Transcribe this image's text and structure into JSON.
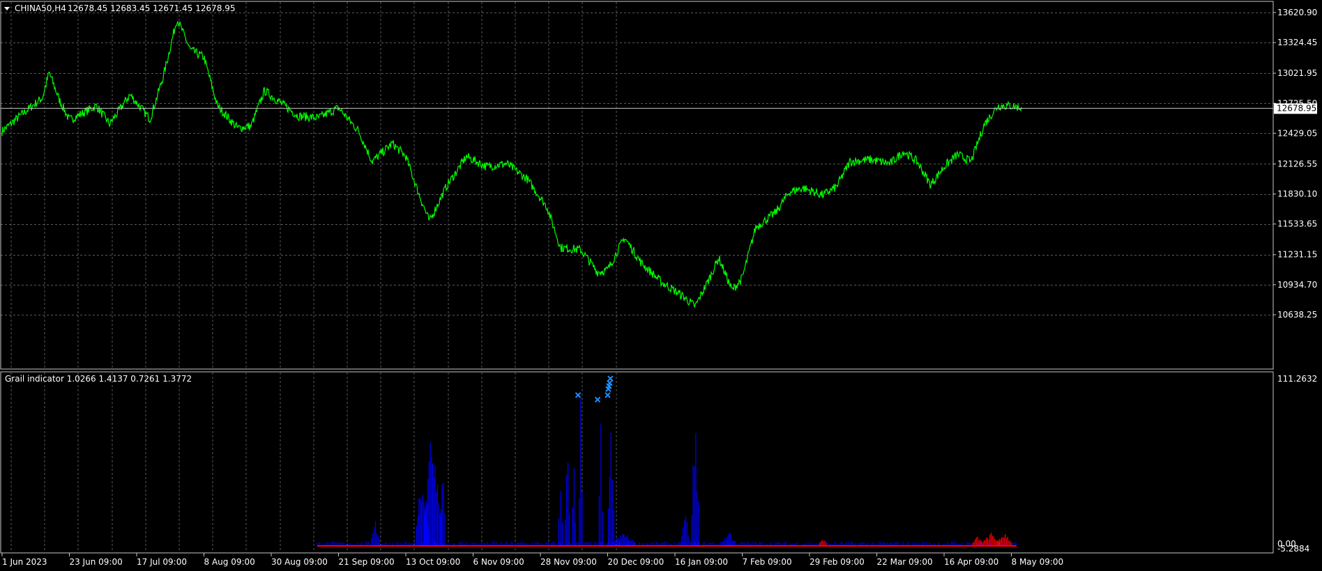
{
  "main_window": {
    "legend_symbol": "CHINA50,H4",
    "legend_ohlc": "12678.45 12683.45 12671.45 12678.95",
    "current_price": "12678.95"
  },
  "indicator_window": {
    "legend": "Grail indicator 1.0266 1.4137 0.7261 1.3772"
  },
  "colors": {
    "background": "#000000",
    "grid": "#5a5a5a",
    "axis_border": "#c8c8c8",
    "price_line": "#00ff00",
    "current_price_line": "#c0c0c0",
    "indicator_blue": "#0000ff",
    "indicator_red": "#ff0000",
    "marker": "#1e90ff"
  },
  "chart_data": [
    {
      "type": "line",
      "series": [
        {
          "name": "CHINA50,H4",
          "x": [
            "1 Jun 2023",
            "23 Jun 09:00",
            "17 Jul 09:00",
            "8 Aug 09:00",
            "30 Aug 09:00",
            "21 Sep 09:00",
            "13 Oct 09:00",
            "6 Nov 09:00",
            "28 Nov 09:00",
            "20 Dec 09:00",
            "16 Jan 09:00",
            "7 Feb 09:00",
            "29 Feb 09:00",
            "22 Mar 09:00",
            "16 Apr 09:00",
            "8 May 09:00"
          ],
          "keypoints": [
            {
              "t": 0.0,
              "v": 12450
            },
            {
              "t": 0.3,
              "v": 12620
            },
            {
              "t": 0.6,
              "v": 12780
            },
            {
              "t": 0.7,
              "v": 13030
            },
            {
              "t": 0.85,
              "v": 12760
            },
            {
              "t": 1.0,
              "v": 12560
            },
            {
              "t": 1.4,
              "v": 12700
            },
            {
              "t": 1.6,
              "v": 12520
            },
            {
              "t": 1.9,
              "v": 12810
            },
            {
              "t": 2.2,
              "v": 12570
            },
            {
              "t": 2.4,
              "v": 13000
            },
            {
              "t": 2.6,
              "v": 13560
            },
            {
              "t": 2.8,
              "v": 13250
            },
            {
              "t": 3.0,
              "v": 13180
            },
            {
              "t": 3.2,
              "v": 12700
            },
            {
              "t": 3.5,
              "v": 12480
            },
            {
              "t": 3.7,
              "v": 12500
            },
            {
              "t": 3.9,
              "v": 12850
            },
            {
              "t": 4.2,
              "v": 12700
            },
            {
              "t": 4.4,
              "v": 12600
            },
            {
              "t": 4.7,
              "v": 12580
            },
            {
              "t": 5.0,
              "v": 12680
            },
            {
              "t": 5.3,
              "v": 12450
            },
            {
              "t": 5.5,
              "v": 12150
            },
            {
              "t": 5.8,
              "v": 12330
            },
            {
              "t": 6.0,
              "v": 12200
            },
            {
              "t": 6.2,
              "v": 11820
            },
            {
              "t": 6.35,
              "v": 11560
            },
            {
              "t": 6.6,
              "v": 11900
            },
            {
              "t": 6.9,
              "v": 12200
            },
            {
              "t": 7.2,
              "v": 12100
            },
            {
              "t": 7.5,
              "v": 12130
            },
            {
              "t": 7.8,
              "v": 11980
            },
            {
              "t": 8.1,
              "v": 11700
            },
            {
              "t": 8.3,
              "v": 11300
            },
            {
              "t": 8.6,
              "v": 11280
            },
            {
              "t": 8.85,
              "v": 11060
            },
            {
              "t": 9.0,
              "v": 11080
            },
            {
              "t": 9.25,
              "v": 11400
            },
            {
              "t": 9.5,
              "v": 11150
            },
            {
              "t": 9.8,
              "v": 10960
            },
            {
              "t": 10.1,
              "v": 10830
            },
            {
              "t": 10.3,
              "v": 10720
            },
            {
              "t": 10.5,
              "v": 10980
            },
            {
              "t": 10.65,
              "v": 11200
            },
            {
              "t": 10.85,
              "v": 10880
            },
            {
              "t": 11.0,
              "v": 11000
            },
            {
              "t": 11.2,
              "v": 11500
            },
            {
              "t": 11.5,
              "v": 11650
            },
            {
              "t": 11.7,
              "v": 11850
            },
            {
              "t": 11.9,
              "v": 11890
            },
            {
              "t": 12.2,
              "v": 11820
            },
            {
              "t": 12.4,
              "v": 11900
            },
            {
              "t": 12.6,
              "v": 12150
            },
            {
              "t": 12.9,
              "v": 12170
            },
            {
              "t": 13.2,
              "v": 12130
            },
            {
              "t": 13.4,
              "v": 12250
            },
            {
              "t": 13.6,
              "v": 12150
            },
            {
              "t": 13.8,
              "v": 11920
            },
            {
              "t": 14.0,
              "v": 12100
            },
            {
              "t": 14.2,
              "v": 12220
            },
            {
              "t": 14.4,
              "v": 12150
            },
            {
              "t": 14.6,
              "v": 12520
            },
            {
              "t": 14.8,
              "v": 12700
            },
            {
              "t": 15.0,
              "v": 12700
            },
            {
              "t": 15.15,
              "v": 12679
            }
          ]
        }
      ],
      "current_price": 12678.95,
      "y_ticks": [
        "13620.90",
        "13324.45",
        "13021.95",
        "12725.50",
        "12429.05",
        "12126.55",
        "11830.10",
        "11533.65",
        "11231.15",
        "10934.70",
        "10638.25"
      ],
      "ylim": [
        10570,
        13690
      ],
      "grid": true
    },
    {
      "type": "bar",
      "title": "Grail indicator",
      "series": [
        {
          "name": "blue",
          "spikes": [
            {
              "t": 5.55,
              "v": 18,
              "w": 0.12
            },
            {
              "t": 6.25,
              "v": 55,
              "w": 0.18
            },
            {
              "t": 6.4,
              "v": 85,
              "w": 0.25
            },
            {
              "t": 6.55,
              "v": 78,
              "w": 0.06
            },
            {
              "t": 8.3,
              "v": 50,
              "w": 0.05
            },
            {
              "t": 8.4,
              "v": 78,
              "w": 0.06
            },
            {
              "t": 8.5,
              "v": 70,
              "w": 0.04
            },
            {
              "t": 8.6,
              "v": 100,
              "w": 0.04
            },
            {
              "t": 8.9,
              "v": 96,
              "w": 0.05
            },
            {
              "t": 9.05,
              "v": 110,
              "w": 0.08
            },
            {
              "t": 9.25,
              "v": 10,
              "w": 0.3
            },
            {
              "t": 10.15,
              "v": 28,
              "w": 0.1
            },
            {
              "t": 10.3,
              "v": 92,
              "w": 0.1
            },
            {
              "t": 10.8,
              "v": 10,
              "w": 0.2
            }
          ]
        },
        {
          "name": "red",
          "spikes": [
            {
              "t": 12.2,
              "v": 6,
              "w": 0.1
            },
            {
              "t": 14.5,
              "v": 7,
              "w": 0.15
            },
            {
              "t": 14.7,
              "v": 9,
              "w": 0.25
            },
            {
              "t": 14.9,
              "v": 10,
              "w": 0.2
            }
          ]
        }
      ],
      "markers": [
        {
          "t": 8.56,
          "v": 100
        },
        {
          "t": 8.85,
          "v": 97
        },
        {
          "t": 9.0,
          "v": 100
        },
        {
          "t": 9.01,
          "v": 104
        },
        {
          "t": 9.02,
          "v": 106
        },
        {
          "t": 9.03,
          "v": 108
        },
        {
          "t": 9.04,
          "v": 111
        }
      ],
      "y_ticks": [
        "111.2632",
        "0.00"
      ],
      "y_tick_min": "-5.2884",
      "ylim": [
        -5.2884,
        118
      ],
      "grid": true
    }
  ]
}
